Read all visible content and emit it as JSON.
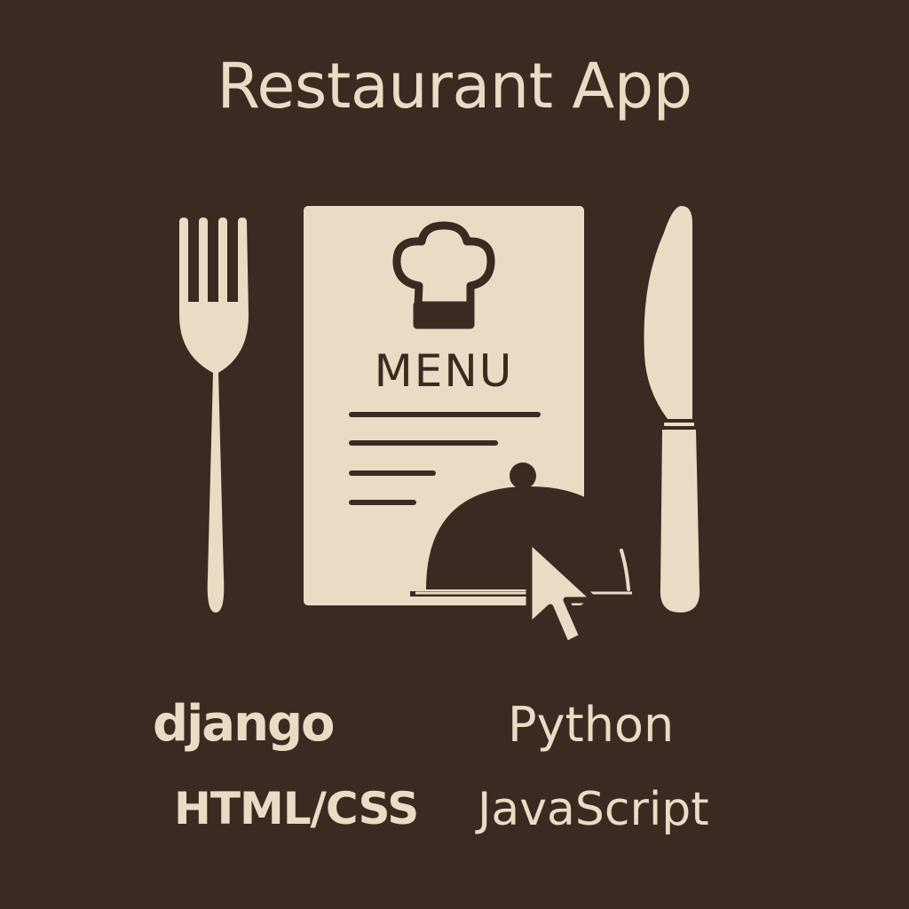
{
  "title": "Restaurant App",
  "menu_card": {
    "heading": "MENU",
    "icon": "chef-hat-icon"
  },
  "icons": [
    "fork-icon",
    "knife-icon",
    "chef-hat-icon",
    "serving-cloche-icon",
    "mouse-pointer-icon"
  ],
  "technologies": {
    "django": "django",
    "python": "Python",
    "htmlcss": "HTML/CSS",
    "javascript": "JavaScript"
  },
  "colors": {
    "background": "#3a2b22",
    "foreground": "#e8dcc4"
  }
}
